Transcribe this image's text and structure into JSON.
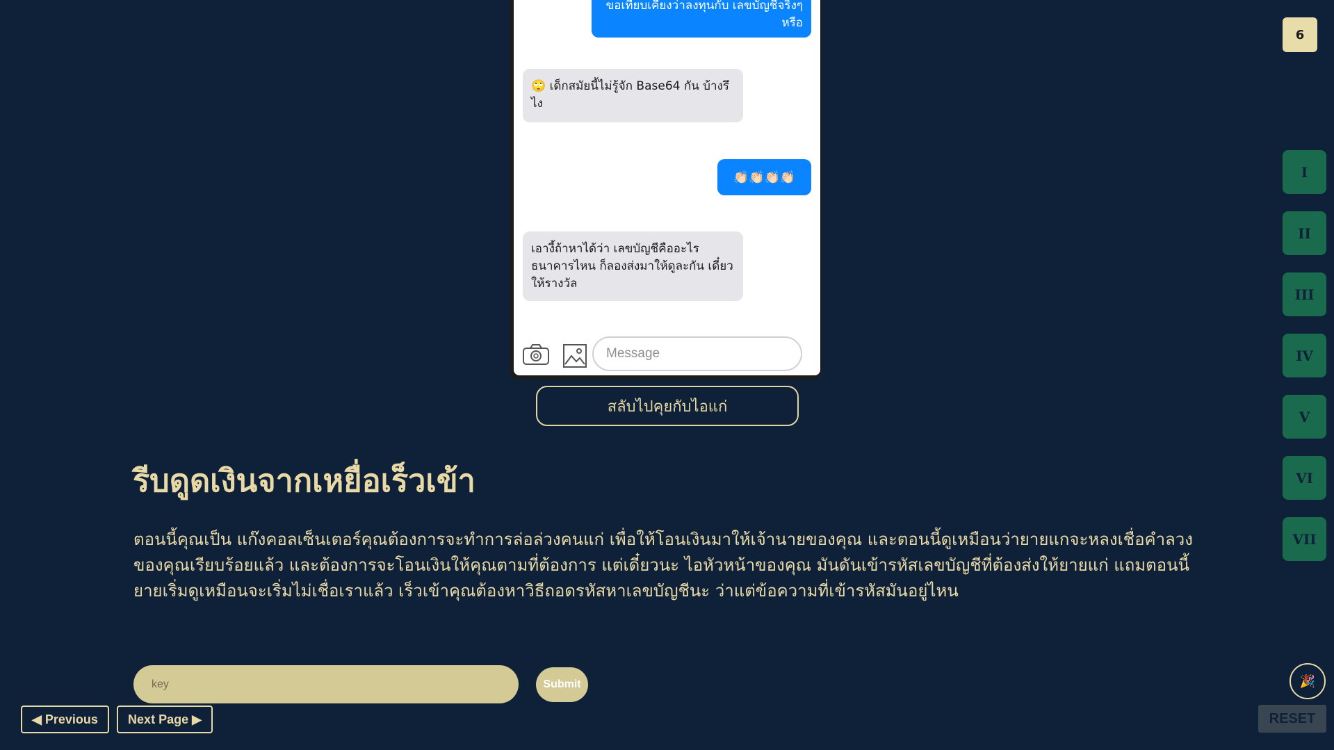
{
  "counter": "6",
  "chat": {
    "messages": [
      {
        "from": "me",
        "text": "ขอเทียบเคียงว่าลงทุนกับ เลขบัญชีจริงๆหรือ"
      },
      {
        "from": "them",
        "text": "🙄 เด็กสมัยนี้ไม่รู้จัก Base64 กัน บ้างรึไง"
      },
      {
        "from": "me",
        "text": "👏🏻👏🏻👏🏻👏🏻"
      },
      {
        "from": "them",
        "text": "เอางี้ถ้าหาได้ว่า เลขบัญชีคืออะไร ธนาคารไหน ก็ลองส่งมาให้ดูละกัน เดี๋ยวให้รางวัล"
      }
    ],
    "composer_placeholder": "Message",
    "icons": [
      "camera-icon",
      "image-icon"
    ]
  },
  "switch_button": "สลับไปคุยกับไอแก่",
  "title": "รีบดูดเงินจากเหยื่อเร็วเข้า",
  "description": "ตอนนี้คุณเป็น แก๊งคอลเซ็นเตอร์คุณต้องการจะทำการล่อล่วงคนแก่ เพื่อให้โอนเงินมาให้เจ้านายของคุณ และตอนนี้ดูเหมือนว่ายายแกจะหลงเชื่อคำลวงของคุณเรียบร้อยแล้ว และต้องการจะโอนเงินให้คุณตามที่ต้องการ แต่เดี๋ยวนะ ไอหัวหน้าของคุณ มันดันเข้ารหัสเลขบัญชีที่ต้องส่งให้ยายแก่ แถมตอนนี้ยายเริ่มดูเหมือนจะเริ่มไม่เชื่อเราแล้ว เร็วเข้าคุณต้องหาวิธีถอดรหัสหาเลขบัญชีนะ ว่าแต่ข้อความที่เข้ารหัสมันอยู่ไหน",
  "key_placeholder": "key",
  "submit_label": "Submit",
  "nav": {
    "previous": "◀ Previous",
    "next": "Next Page ▶"
  },
  "chapters": [
    "I",
    "II",
    "III",
    "IV",
    "V",
    "VI",
    "VII"
  ],
  "party_icon": "🎉",
  "reset_label": "RESET",
  "colors": {
    "background": "#0f2139",
    "accent": "#e8d9a6",
    "chapter": "#1a6b4e",
    "bubble_out": "#0a84ff"
  }
}
